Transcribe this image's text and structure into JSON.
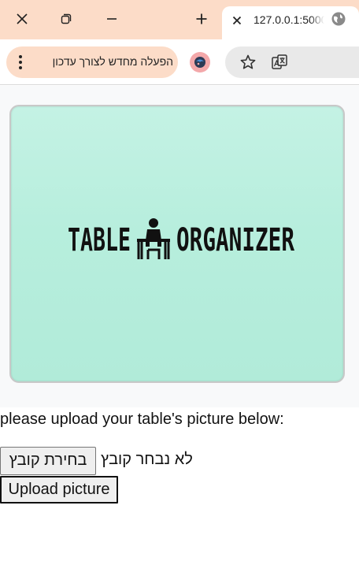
{
  "browser": {
    "tab": {
      "title": "127.0.0.1:5000"
    },
    "update_button": {
      "label": "הפעלה מחדש לצורך עדכון"
    }
  },
  "page": {
    "logo": {
      "text_left": "TABLE",
      "text_right": "ORGANIZER",
      "background": "#b7eedd"
    },
    "upload_prompt": "please upload your table's picture below:",
    "file_input": {
      "button_label": "בחירת קובץ",
      "status": "לא נבחר קובץ"
    },
    "submit_label": "Upload picture"
  },
  "colors": {
    "chrome_accent": "#fcdcc8",
    "avatar": "#f3a8aa"
  }
}
